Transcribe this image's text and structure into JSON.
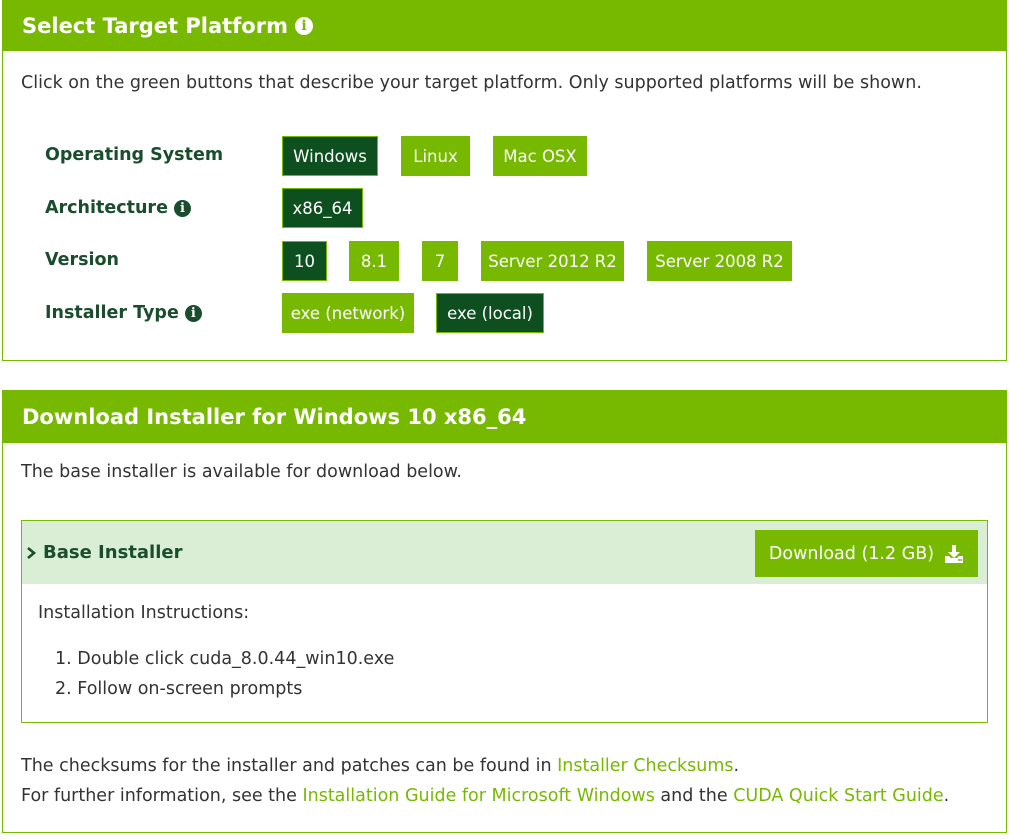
{
  "platform": {
    "title": "Select Target Platform",
    "instructions": "Click on the green buttons that describe your target platform. Only supported platforms will be shown.",
    "rows": {
      "os": {
        "label": "Operating System",
        "options": [
          "Windows",
          "Linux",
          "Mac OSX"
        ],
        "selected": "Windows"
      },
      "arch": {
        "label": "Architecture",
        "options": [
          "x86_64"
        ],
        "selected": "x86_64"
      },
      "version": {
        "label": "Version",
        "options": [
          "10",
          "8.1",
          "7",
          "Server 2012 R2",
          "Server 2008 R2"
        ],
        "selected": "10"
      },
      "installer": {
        "label": "Installer Type",
        "options": [
          "exe (network)",
          "exe (local)"
        ],
        "selected": "exe (local)"
      }
    }
  },
  "download": {
    "title": "Download Installer for Windows 10 x86_64",
    "intro": "The base installer is available for download below.",
    "base": {
      "title": "Base Installer",
      "button_label": "Download (1.2 GB)",
      "instructions_title": "Installation Instructions:",
      "steps": [
        "1. Double click cuda_8.0.44_win10.exe",
        "2. Follow on-screen prompts"
      ]
    },
    "checksums_prefix": "The checksums for the installer and patches can be found in ",
    "checksums_link": "Installer Checksums",
    "checksums_suffix": ".",
    "info_prefix": "For further information, see the ",
    "info_link1": "Installation Guide for Microsoft Windows",
    "info_mid": " and the ",
    "info_link2": "CUDA Quick Start Guide",
    "info_suffix": "."
  },
  "colors": {
    "accent": "#76b900",
    "selected": "#0d4f1f",
    "label": "#1a4d2e",
    "base_header_bg": "#d9eed4"
  },
  "icons": {
    "info": "info-circle-icon",
    "chevron": "chevron-right-icon",
    "download": "download-icon"
  }
}
